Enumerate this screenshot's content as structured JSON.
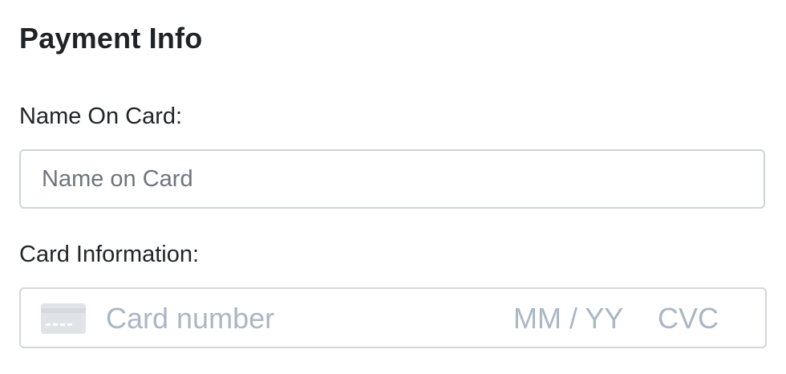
{
  "form": {
    "title": "Payment Info",
    "name_label": "Name On Card:",
    "name_placeholder": "Name on Card",
    "card_label": "Card Information:",
    "card": {
      "number_placeholder": "Card number",
      "expiry_placeholder": "MM / YY",
      "cvc_placeholder": "CVC",
      "icon": "credit-card-icon"
    }
  },
  "colors": {
    "text": "#212529",
    "placeholder": "#6c757d",
    "card_placeholder": "#aab7c4",
    "border": "#ced4da"
  }
}
